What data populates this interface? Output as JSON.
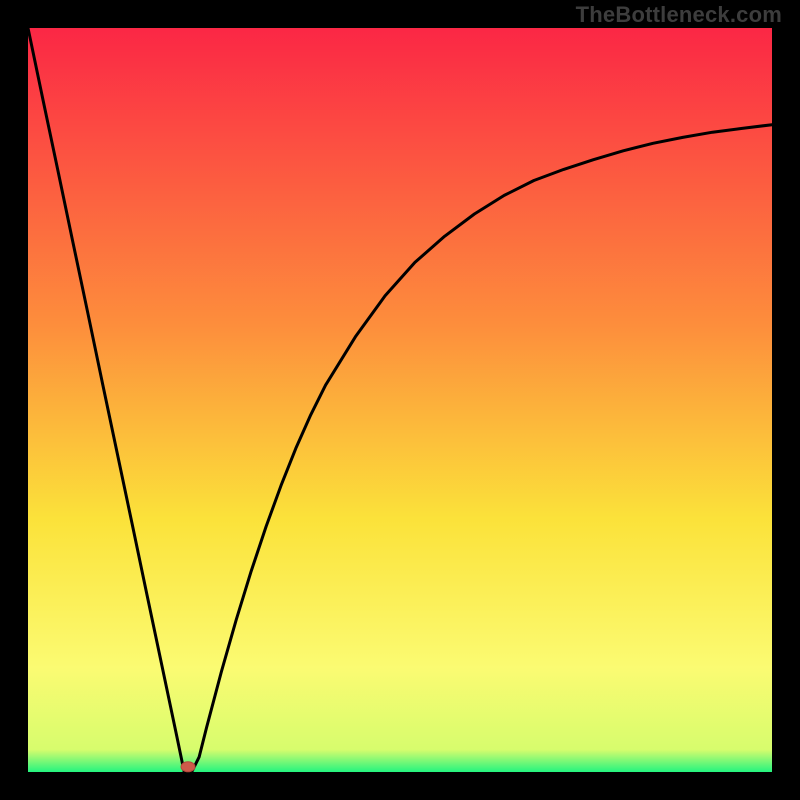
{
  "watermark": "TheBottleneck.com",
  "chart_data": {
    "type": "line",
    "title": "",
    "xlabel": "",
    "ylabel": "",
    "xlim": [
      0,
      100
    ],
    "ylim": [
      0,
      100
    ],
    "x": [
      0,
      2,
      4,
      6,
      8,
      10,
      12,
      14,
      16,
      18,
      20,
      21,
      22,
      23,
      24,
      26,
      28,
      30,
      32,
      34,
      36,
      38,
      40,
      44,
      48,
      52,
      56,
      60,
      64,
      68,
      72,
      76,
      80,
      84,
      88,
      92,
      96,
      100
    ],
    "values": [
      100,
      90.4,
      80.9,
      71.4,
      61.9,
      52.3,
      42.8,
      33.3,
      23.8,
      14.3,
      4.8,
      0,
      0,
      2.0,
      6.0,
      13.5,
      20.5,
      27.0,
      33.0,
      38.5,
      43.5,
      48.0,
      52.0,
      58.5,
      64.0,
      68.5,
      72.0,
      75.0,
      77.5,
      79.5,
      81.0,
      82.3,
      83.5,
      84.5,
      85.3,
      86.0,
      86.5,
      87.0
    ],
    "marker": {
      "x": 21.5,
      "y": 0.7
    },
    "grid": false,
    "legend": false,
    "colors": {
      "gradient_top": "#fb2745",
      "gradient_mid1": "#fd8e3c",
      "gradient_mid2": "#fbe23a",
      "gradient_mid3": "#fbfb72",
      "gradient_bottom": "#24f47f",
      "curve": "#000000",
      "marker": "#cf5b4a",
      "frame": "#000000"
    }
  }
}
